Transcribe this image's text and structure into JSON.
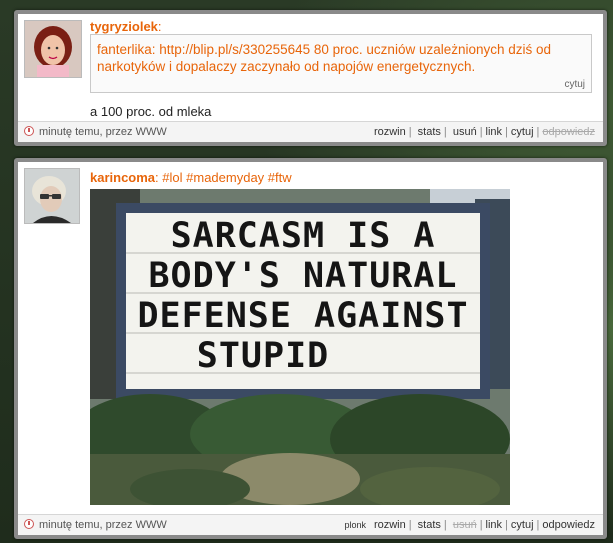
{
  "posts": [
    {
      "author": "tygryziolek",
      "colon": ":",
      "quote": {
        "text": "fanterlika: http://blip.pl/s/330255645 80 proc. uczniów uzależnionych dziś od narkotyków i dopalaczy zaczynało od napojów energetycznych.",
        "cite": "cytuj"
      },
      "text": "a 100 proc. od mleka",
      "footer": {
        "time": "minutę temu, przez WWW",
        "actions": {
          "expand": "rozwin",
          "stats": "stats",
          "delete": "usuń",
          "link": "link",
          "quote": "cytuj",
          "reply": "odpowiedz"
        }
      }
    },
    {
      "author": "karincoma",
      "colon": ":",
      "tags": "#lol #mademyday #ftw",
      "image_text": [
        "SARCASM IS A",
        "BODY'S NATURAL",
        "DEFENSE AGAINST",
        "STUPID"
      ],
      "footer": {
        "time": "minutę temu, przez WWW",
        "actions": {
          "plonk": "plonk",
          "expand": "rozwin",
          "stats": "stats",
          "delete": "usuń",
          "link": "link",
          "quote": "cytuj",
          "reply": "odpowiedz"
        }
      }
    }
  ],
  "colors": {
    "accent": "#e8650a",
    "card_border": "#8a8a8a"
  }
}
